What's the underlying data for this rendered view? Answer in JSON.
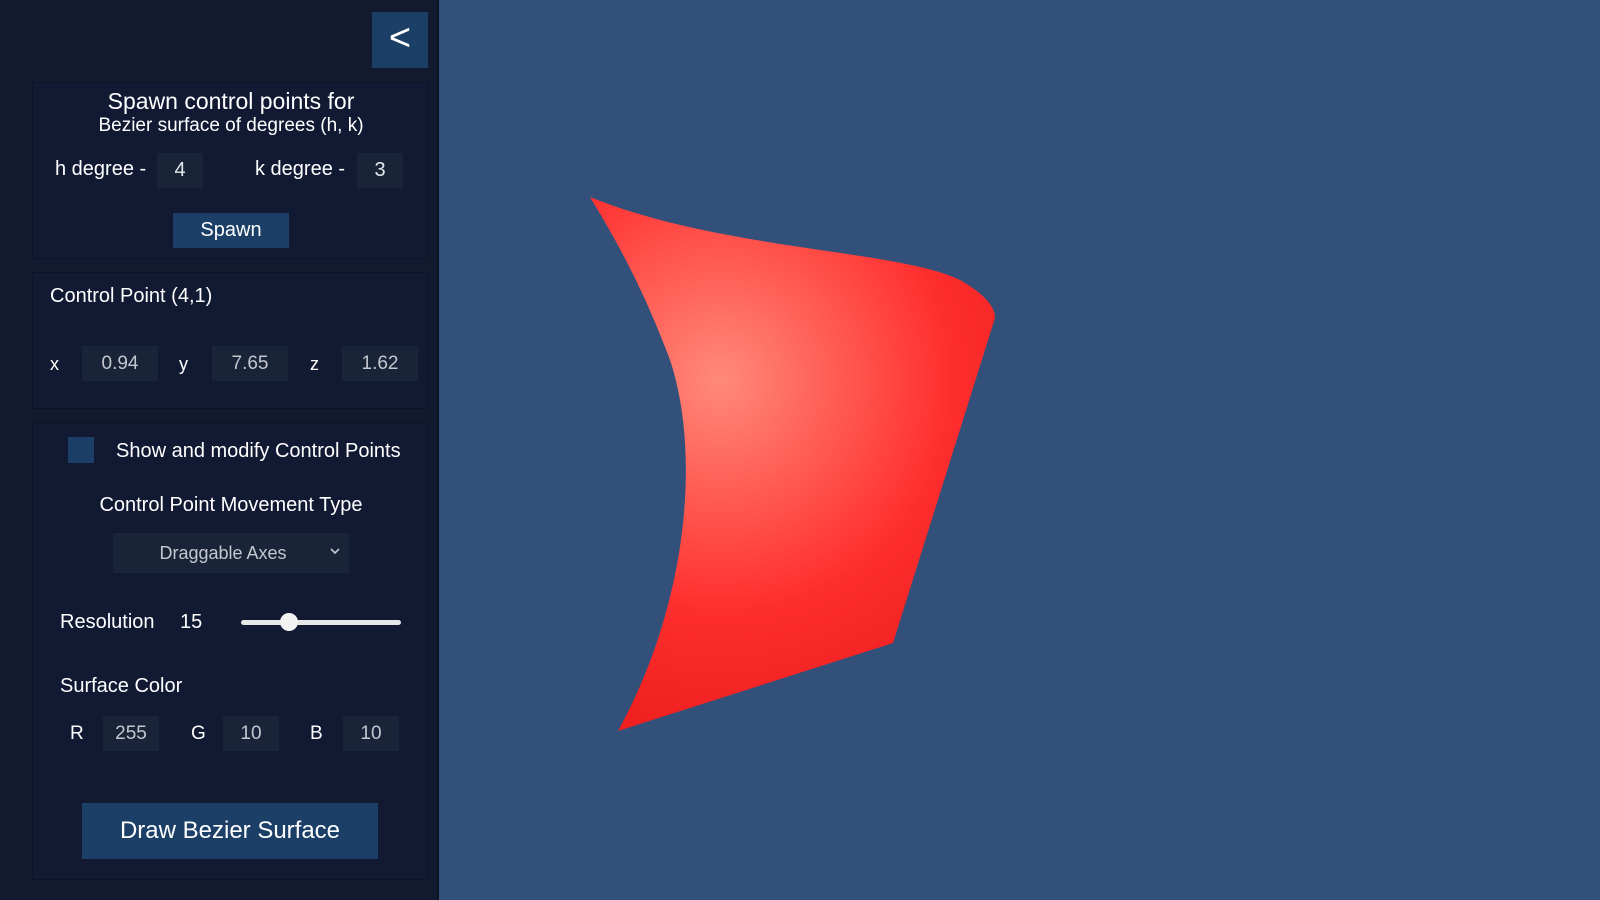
{
  "panel": {
    "collapse_label": "<",
    "spawn": {
      "title": "Spawn control points for",
      "subtitle": "Bezier surface of degrees (h, k)",
      "h_label": "h degree -",
      "h_value": "4",
      "k_label": "k degree -",
      "k_value": "3",
      "spawn_label": "Spawn"
    },
    "control_point": {
      "title": "Control Point (4,1)",
      "x_label": "x",
      "x_value": "0.94",
      "y_label": "y",
      "y_value": "7.65",
      "z_label": "z",
      "z_value": "1.62"
    },
    "options": {
      "show_points_label": "Show and modify Control Points",
      "show_points_checked": false,
      "movement_title": "Control Point Movement Type",
      "movement_selected": "Draggable Axes",
      "resolution_label": "Resolution",
      "resolution_value": "15",
      "resolution_fraction": 0.3,
      "color_title": "Surface Color",
      "r_label": "R",
      "r_value": "255",
      "g_label": "G",
      "g_value": "10",
      "b_label": "B",
      "b_value": "10",
      "draw_label": "Draw Bezier Surface"
    }
  },
  "viewport": {
    "background_color": "#32507a",
    "surface_color": "#ff0a0a",
    "surface_highlight": "#ff8a7a"
  }
}
